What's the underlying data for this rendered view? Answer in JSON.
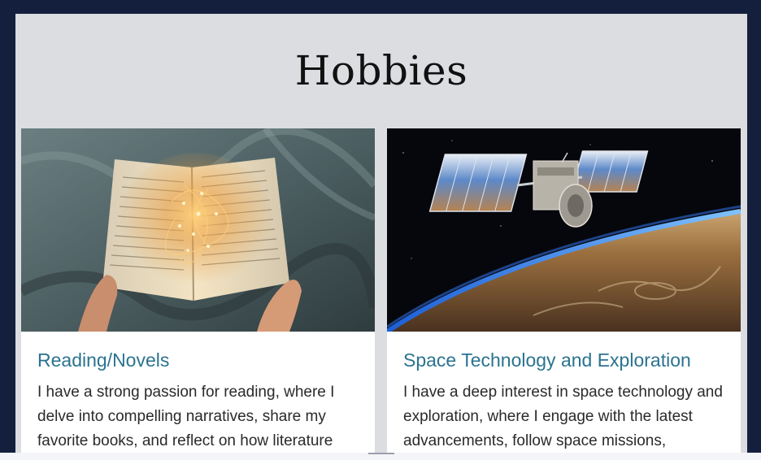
{
  "page": {
    "title": "Hobbies"
  },
  "cards": [
    {
      "title": "Reading/Novels",
      "text": "I have a strong passion for reading, where I delve into compelling narratives, share my favorite books, and reflect on how literature",
      "image_icon": "open-book-with-lights-image"
    },
    {
      "title": "Space Technology and Exploration",
      "text": "I have a deep interest in space technology and exploration, where I engage with the latest advancements, follow space missions,",
      "image_icon": "satellite-orbiting-earth-image"
    }
  ],
  "colors": {
    "outer_background": "#141f3d",
    "panel_background": "#dcdde1",
    "card_title": "#2b7390",
    "body_text": "#2a2a2a"
  }
}
